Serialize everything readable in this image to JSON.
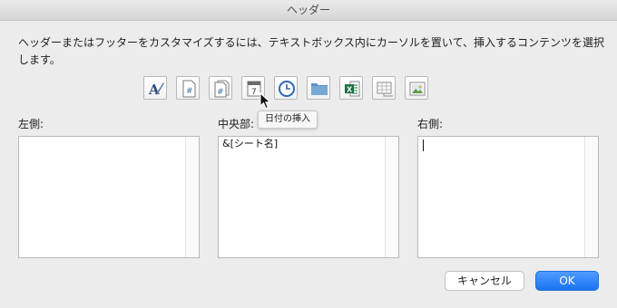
{
  "window": {
    "title": "ヘッダー"
  },
  "instructions": "ヘッダーまたはフッターをカスタマイズするには、テキストボックス内にカーソルを置いて、挿入するコンテンツを選択します。",
  "toolbar": {
    "buttons": [
      {
        "icon": "format-text-icon"
      },
      {
        "icon": "page-number-icon"
      },
      {
        "icon": "page-count-icon"
      },
      {
        "icon": "insert-date-icon"
      },
      {
        "icon": "insert-time-icon"
      },
      {
        "icon": "file-path-icon"
      },
      {
        "icon": "file-name-icon"
      },
      {
        "icon": "sheet-name-icon"
      },
      {
        "icon": "insert-picture-icon"
      }
    ],
    "tooltip": "日付の挿入"
  },
  "sections": {
    "left": {
      "label": "左側:",
      "value": ""
    },
    "center": {
      "label": "中央部:",
      "value": "&[シート名]"
    },
    "right": {
      "label": "右側:",
      "value": ""
    }
  },
  "buttons": {
    "cancel": "キャンセル",
    "ok": "OK"
  },
  "colors": {
    "accent": "#1a73f0",
    "excel_green": "#1e7145"
  }
}
